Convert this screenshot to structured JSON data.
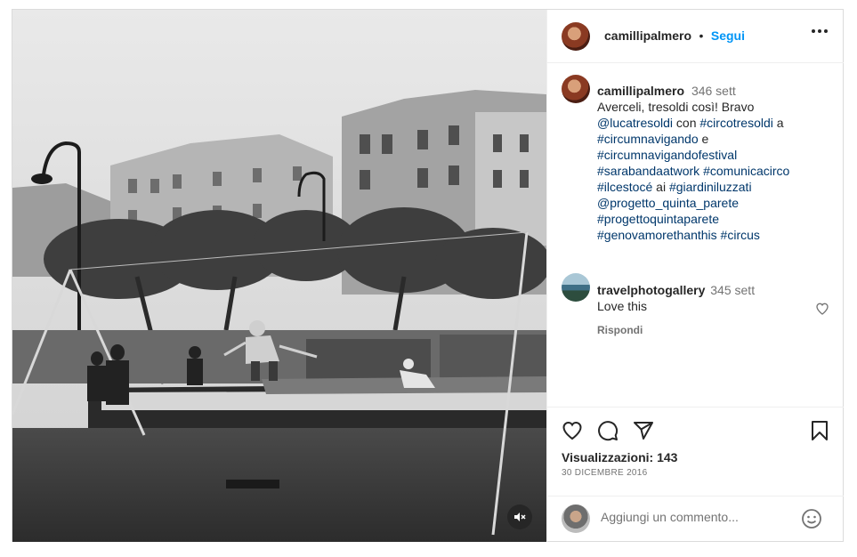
{
  "post": {
    "author": "camillipalmero",
    "separator": "•",
    "follow_label": "Segui",
    "more_icon": "more-horizontal-icon"
  },
  "caption": {
    "username": "camillipalmero",
    "time": "346 sett",
    "line1": "Averceli, tresoldi così! Bravo",
    "mention1": "@lucatresoldi",
    "con": " con ",
    "tag1": "#circotresoldi",
    "a": " a",
    "tag2": "#circumnavigando",
    "e": " e",
    "tag3": "#circumnavigandofestival",
    "tag4": "#sarabandaatwork",
    "tag5": "#comunicacirco",
    "tag6": "#ilcestocé",
    "ai": " ai ",
    "tag7": "#giardiniluzzati",
    "mention2": "@progetto_quinta_parete",
    "tag8": "#progettoquintaparete",
    "tag9": "#genovamorethanthis",
    "tag10": "#circus"
  },
  "comment": {
    "username": "travelphotogallery",
    "time": "345 sett",
    "text": "Love this",
    "reply_label": "Rispondi"
  },
  "actions": {
    "views": "Visualizzazioni: 143",
    "date": "30 DICEMBRE 2016"
  },
  "add_comment": {
    "placeholder": "Aggiungi un commento..."
  },
  "colors": {
    "link": "#00376b",
    "follow": "#0095f6",
    "muted": "#737373"
  }
}
